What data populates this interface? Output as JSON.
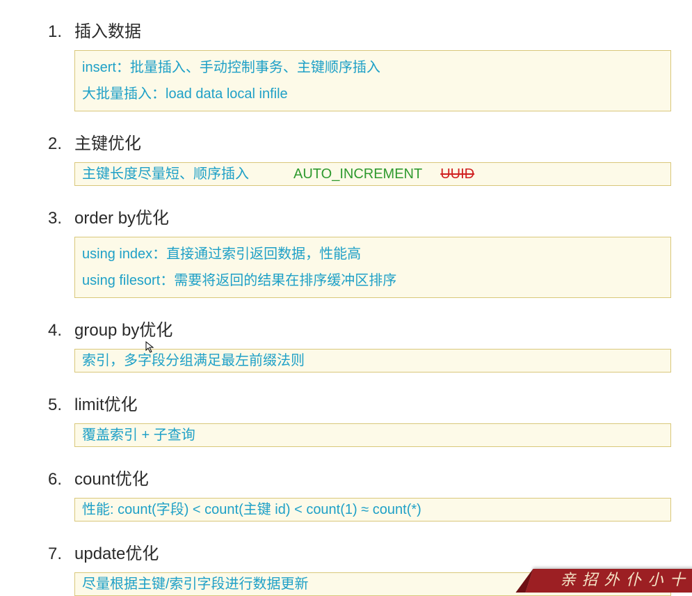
{
  "items": [
    {
      "num": "1.",
      "title": "插入数据",
      "box_lines": [
        "insert：批量插入、手动控制事务、主键顺序插入",
        "大批量插入：load data local infile"
      ],
      "tight": false
    },
    {
      "num": "2.",
      "title": "主键优化",
      "box_special": {
        "left": "主键长度尽量短、顺序插入",
        "green": "AUTO_INCREMENT",
        "strike": "UUID"
      },
      "tight": true
    },
    {
      "num": "3.",
      "title": "order by优化",
      "box_lines": [
        "using index：直接通过索引返回数据，性能高",
        "using filesort：需要将返回的结果在排序缓冲区排序"
      ],
      "tight": false
    },
    {
      "num": "4.",
      "title": "group by优化",
      "box_lines": [
        "索引，多字段分组满足最左前缀法则"
      ],
      "tight": true
    },
    {
      "num": "5.",
      "title": "limit优化",
      "box_lines": [
        "覆盖索引 + 子查询"
      ],
      "tight": true
    },
    {
      "num": "6.",
      "title": "count优化",
      "box_lines": [
        "性能: count(字段) < count(主键 id) < count(1) ≈ count(*)"
      ],
      "tight": true
    },
    {
      "num": "7.",
      "title": "update优化",
      "box_lines": [
        "尽量根据主键/索引字段进行数据更新"
      ],
      "tight": true
    }
  ],
  "footer": "亲 招 外 仆 小 十"
}
